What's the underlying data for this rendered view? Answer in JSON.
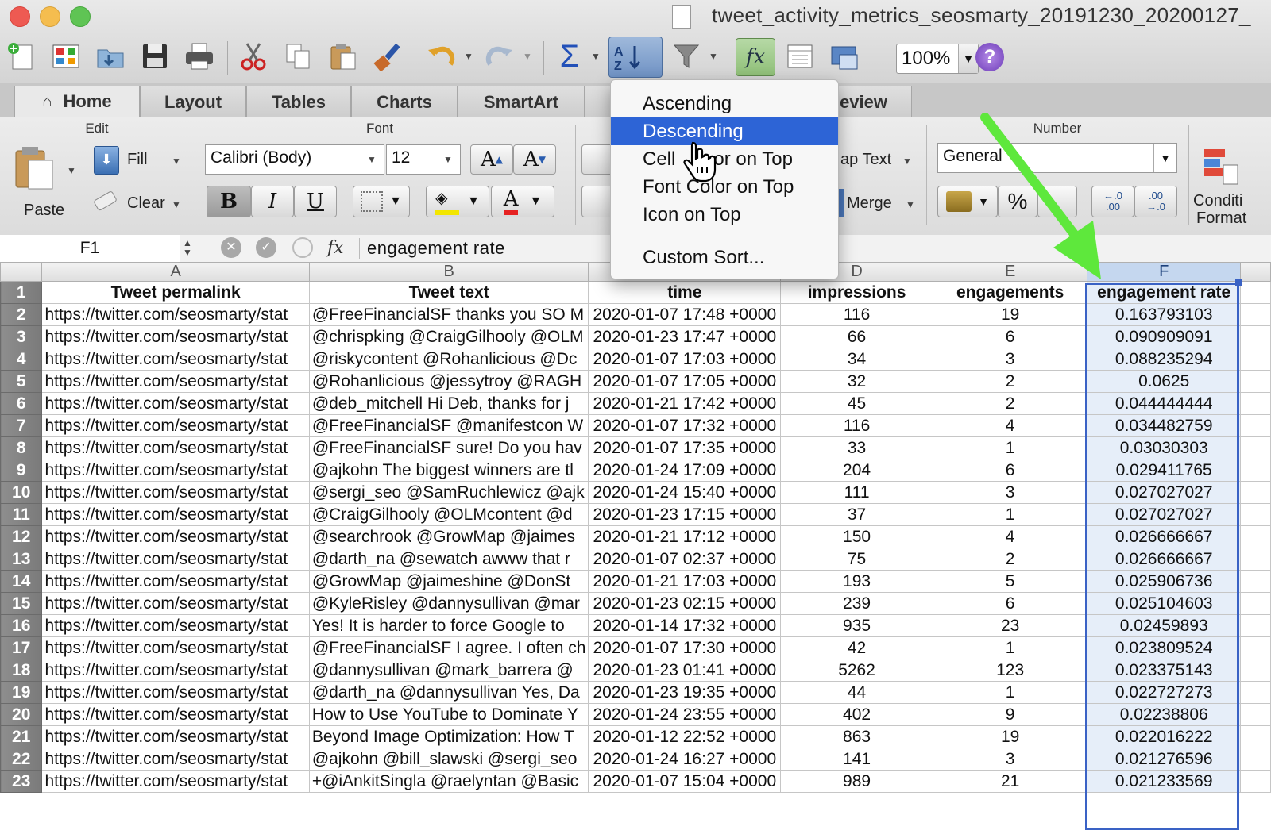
{
  "window": {
    "title": "tweet_activity_metrics_seosmarty_20191230_20200127_",
    "traffic_lights": {
      "close": "#ee5a52",
      "minimize": "#f5bd4f",
      "zoom": "#5fc454"
    }
  },
  "toolbar": {
    "icons": [
      "new-icon",
      "gallery-icon",
      "open-icon",
      "save-icon",
      "print-icon",
      "cut-icon",
      "copy-icon",
      "paste-icon",
      "format-painter-icon",
      "undo-icon",
      "redo-icon",
      "sum-icon",
      "sort-icon",
      "filter-icon",
      "function-icon",
      "form-icon",
      "media-icon",
      "help-icon"
    ],
    "zoom": "100%"
  },
  "ribbon": {
    "tabs": [
      "Home",
      "Layout",
      "Tables",
      "Charts",
      "SmartArt",
      "eview"
    ],
    "active_tab": "Home",
    "groups": {
      "edit": {
        "title": "Edit",
        "paste": "Paste",
        "fill": "Fill",
        "clear": "Clear"
      },
      "font": {
        "title": "Font",
        "family": "Calibri (Body)",
        "size": "12",
        "bold": "B",
        "italic": "I",
        "underline": "U",
        "grow": "A",
        "shrink": "A",
        "font_color": "A"
      },
      "alignment": {
        "wrap": "ap Text",
        "merge": "Merge"
      },
      "number": {
        "title": "Number",
        "format": "General",
        "percent": "%",
        "comma": ",",
        "inc_decimal_a": "←.0",
        "inc_decimal_b": ".00",
        "dec_decimal_a": ".00",
        "dec_decimal_b": "→.0"
      },
      "format": {
        "label1": "Conditi",
        "label2": "Format"
      }
    }
  },
  "formula_bar": {
    "cell_ref": "F1",
    "content": "engagement rate",
    "fx": "fx"
  },
  "sort_menu": {
    "items": [
      "Ascending",
      "Descending",
      "Cell Color on Top",
      "Font Color on Top",
      "Icon on Top",
      "Custom Sort..."
    ],
    "highlighted": "Descending",
    "obscured_item_visible_text": [
      "Cell",
      "or on Top"
    ]
  },
  "sheet": {
    "columns": [
      "A",
      "B",
      "C",
      "D",
      "E",
      "F"
    ],
    "headers": [
      "Tweet permalink",
      "Tweet text",
      "time",
      "impressions",
      "engagements",
      "engagement rate"
    ],
    "rows": [
      {
        "n": "2",
        "a": "https://twitter.com/seosmarty/stat",
        "b": "@FreeFinancialSF thanks you SO M",
        "c": "2020-01-07 17:48 +0000",
        "d": "116",
        "e": "19",
        "f": "0.163793103"
      },
      {
        "n": "3",
        "a": "https://twitter.com/seosmarty/stat",
        "b": "@chrispking @CraigGilhooly @OLM",
        "c": "2020-01-23 17:47 +0000",
        "d": "66",
        "e": "6",
        "f": "0.090909091"
      },
      {
        "n": "4",
        "a": "https://twitter.com/seosmarty/stat",
        "b": "@riskycontent @Rohanlicious @Dc",
        "c": "2020-01-07 17:03 +0000",
        "d": "34",
        "e": "3",
        "f": "0.088235294"
      },
      {
        "n": "5",
        "a": "https://twitter.com/seosmarty/stat",
        "b": "@Rohanlicious @jessytroy @RAGH",
        "c": "2020-01-07 17:05 +0000",
        "d": "32",
        "e": "2",
        "f": "0.0625"
      },
      {
        "n": "6",
        "a": "https://twitter.com/seosmarty/stat",
        "b": "@deb_mitchell Hi Deb, thanks for j",
        "c": "2020-01-21 17:42 +0000",
        "d": "45",
        "e": "2",
        "f": "0.044444444"
      },
      {
        "n": "7",
        "a": "https://twitter.com/seosmarty/stat",
        "b": "@FreeFinancialSF @manifestcon W",
        "c": "2020-01-07 17:32 +0000",
        "d": "116",
        "e": "4",
        "f": "0.034482759"
      },
      {
        "n": "8",
        "a": "https://twitter.com/seosmarty/stat",
        "b": "@FreeFinancialSF sure! Do you hav",
        "c": "2020-01-07 17:35 +0000",
        "d": "33",
        "e": "1",
        "f": "0.03030303"
      },
      {
        "n": "9",
        "a": "https://twitter.com/seosmarty/stat",
        "b": "@ajkohn The biggest winners are tl",
        "c": "2020-01-24 17:09 +0000",
        "d": "204",
        "e": "6",
        "f": "0.029411765"
      },
      {
        "n": "10",
        "a": "https://twitter.com/seosmarty/stat",
        "b": "@sergi_seo @SamRuchlewicz @ajk",
        "c": "2020-01-24 15:40 +0000",
        "d": "111",
        "e": "3",
        "f": "0.027027027"
      },
      {
        "n": "11",
        "a": "https://twitter.com/seosmarty/stat",
        "b": "@CraigGilhooly @OLMcontent @d",
        "c": "2020-01-23 17:15 +0000",
        "d": "37",
        "e": "1",
        "f": "0.027027027"
      },
      {
        "n": "12",
        "a": "https://twitter.com/seosmarty/stat",
        "b": "@searchrook @GrowMap @jaimes",
        "c": "2020-01-21 17:12 +0000",
        "d": "150",
        "e": "4",
        "f": "0.026666667"
      },
      {
        "n": "13",
        "a": "https://twitter.com/seosmarty/stat",
        "b": "@darth_na @sewatch awww that r",
        "c": "2020-01-07 02:37 +0000",
        "d": "75",
        "e": "2",
        "f": "0.026666667"
      },
      {
        "n": "14",
        "a": "https://twitter.com/seosmarty/stat",
        "b": "@GrowMap @jaimeshine @DonSt",
        "c": "2020-01-21 17:03 +0000",
        "d": "193",
        "e": "5",
        "f": "0.025906736"
      },
      {
        "n": "15",
        "a": "https://twitter.com/seosmarty/stat",
        "b": "@KyleRisley @dannysullivan @mar",
        "c": "2020-01-23 02:15 +0000",
        "d": "239",
        "e": "6",
        "f": "0.025104603"
      },
      {
        "n": "16",
        "a": "https://twitter.com/seosmarty/stat",
        "b": "Yes! It is harder to force Google to",
        "c": "2020-01-14 17:32 +0000",
        "d": "935",
        "e": "23",
        "f": "0.02459893"
      },
      {
        "n": "17",
        "a": "https://twitter.com/seosmarty/stat",
        "b": "@FreeFinancialSF I agree. I often ch",
        "c": "2020-01-07 17:30 +0000",
        "d": "42",
        "e": "1",
        "f": "0.023809524"
      },
      {
        "n": "18",
        "a": "https://twitter.com/seosmarty/stat",
        "b": "@dannysullivan @mark_barrera @",
        "c": "2020-01-23 01:41 +0000",
        "d": "5262",
        "e": "123",
        "f": "0.023375143"
      },
      {
        "n": "19",
        "a": "https://twitter.com/seosmarty/stat",
        "b": "@darth_na @dannysullivan Yes, Da",
        "c": "2020-01-23 19:35 +0000",
        "d": "44",
        "e": "1",
        "f": "0.022727273"
      },
      {
        "n": "20",
        "a": "https://twitter.com/seosmarty/stat",
        "b": "How to Use YouTube to Dominate Y",
        "c": "2020-01-24 23:55 +0000",
        "d": "402",
        "e": "9",
        "f": "0.02238806"
      },
      {
        "n": "21",
        "a": "https://twitter.com/seosmarty/stat",
        "b": "Beyond Image Optimization: How T",
        "c": "2020-01-12 22:52 +0000",
        "d": "863",
        "e": "19",
        "f": "0.022016222"
      },
      {
        "n": "22",
        "a": "https://twitter.com/seosmarty/stat",
        "b": "@ajkohn @bill_slawski @sergi_seo",
        "c": "2020-01-24 16:27 +0000",
        "d": "141",
        "e": "3",
        "f": "0.021276596"
      },
      {
        "n": "23",
        "a": "https://twitter.com/seosmarty/stat",
        "b": "+@iAnkitSingla @raelyntan @Basic",
        "c": "2020-01-07 15:04 +0000",
        "d": "989",
        "e": "21",
        "f": "0.021233569"
      }
    ],
    "selected_column": "F"
  },
  "annotation": {
    "arrow_color": "#5ee83c"
  }
}
